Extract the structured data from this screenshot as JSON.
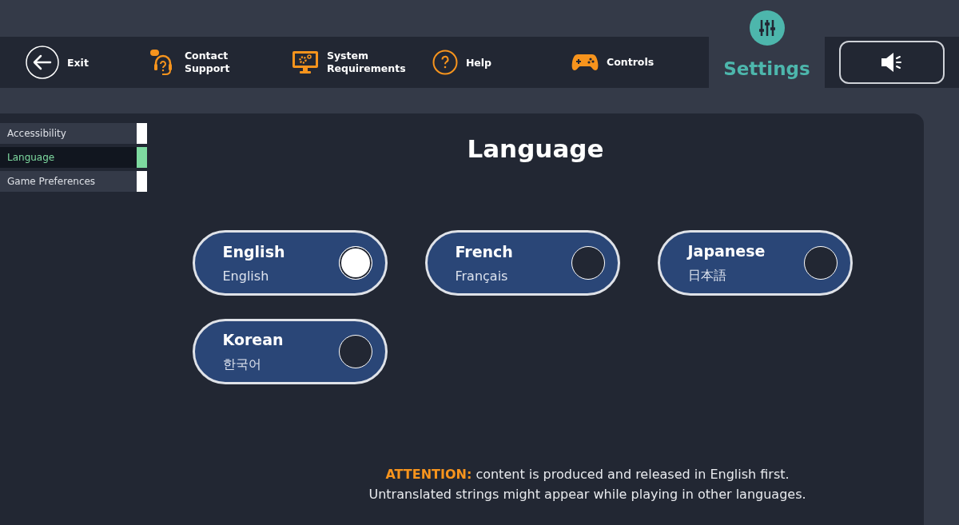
{
  "nav": [
    {
      "kind": "exit",
      "label": "Exit"
    },
    {
      "kind": "support",
      "label": "Contact Support"
    },
    {
      "kind": "monitor",
      "label": "System Requirements"
    },
    {
      "kind": "help",
      "label": "Help"
    },
    {
      "kind": "gamepad",
      "label": "Controls"
    }
  ],
  "settings_tab": {
    "label": "Settings",
    "selected": true
  },
  "sound": {
    "muted": false
  },
  "sidebar": {
    "items": [
      {
        "label": "Accessibility",
        "selected": false
      },
      {
        "label": "Language",
        "selected": true
      },
      {
        "label": "Game Preferences",
        "selected": false
      }
    ]
  },
  "title": "Language",
  "languages": [
    {
      "name": "English",
      "native": "English",
      "selected": true
    },
    {
      "name": "French",
      "native": "Français",
      "selected": false
    },
    {
      "name": "Japanese",
      "native": "日本語",
      "selected": false
    },
    {
      "name": "Korean",
      "native": "한국어",
      "selected": false
    }
  ],
  "notice": {
    "label": "ATTENTION:",
    "lines": [
      "content is produced and released in English first.",
      "Untranslated strings might appear while playing in other languages."
    ]
  }
}
